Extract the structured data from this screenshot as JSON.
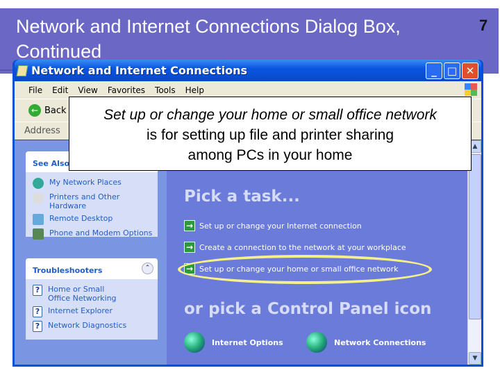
{
  "slide": {
    "title": "Network and Internet Connections Dialog Box, Continued",
    "page_number": "7",
    "band_color": "#6b67c5"
  },
  "window": {
    "title": "Network and Internet Connections",
    "menu": [
      "File",
      "Edit",
      "View",
      "Favorites",
      "Tools",
      "Help"
    ],
    "toolbar": {
      "back_label": "Back"
    },
    "address_label": "Address",
    "see_also": {
      "title": "See Also",
      "items": [
        "My Network Places",
        "Printers and Other Hardware",
        "Remote Desktop",
        "Phone and Modem Options"
      ]
    },
    "troubleshooters": {
      "title": "Troubleshooters",
      "items": [
        "Home or Small Office Networking",
        "Internet Explorer",
        "Network Diagnostics"
      ]
    },
    "pick_task_heading": "Pick a task...",
    "tasks": [
      "Set up or change your Internet connection",
      "Create a connection to the network at your workplace",
      "Set up or change your home or small office network"
    ],
    "pick_icon_heading": "or pick a Control Panel icon",
    "icons": [
      "Internet Options",
      "Network Connections"
    ]
  },
  "callout": {
    "line1": "Set up or change your home or small office network",
    "line2": "is for setting up file and printer sharing",
    "line3": "among PCs in your home"
  },
  "highlight_color": "#f5f08a"
}
